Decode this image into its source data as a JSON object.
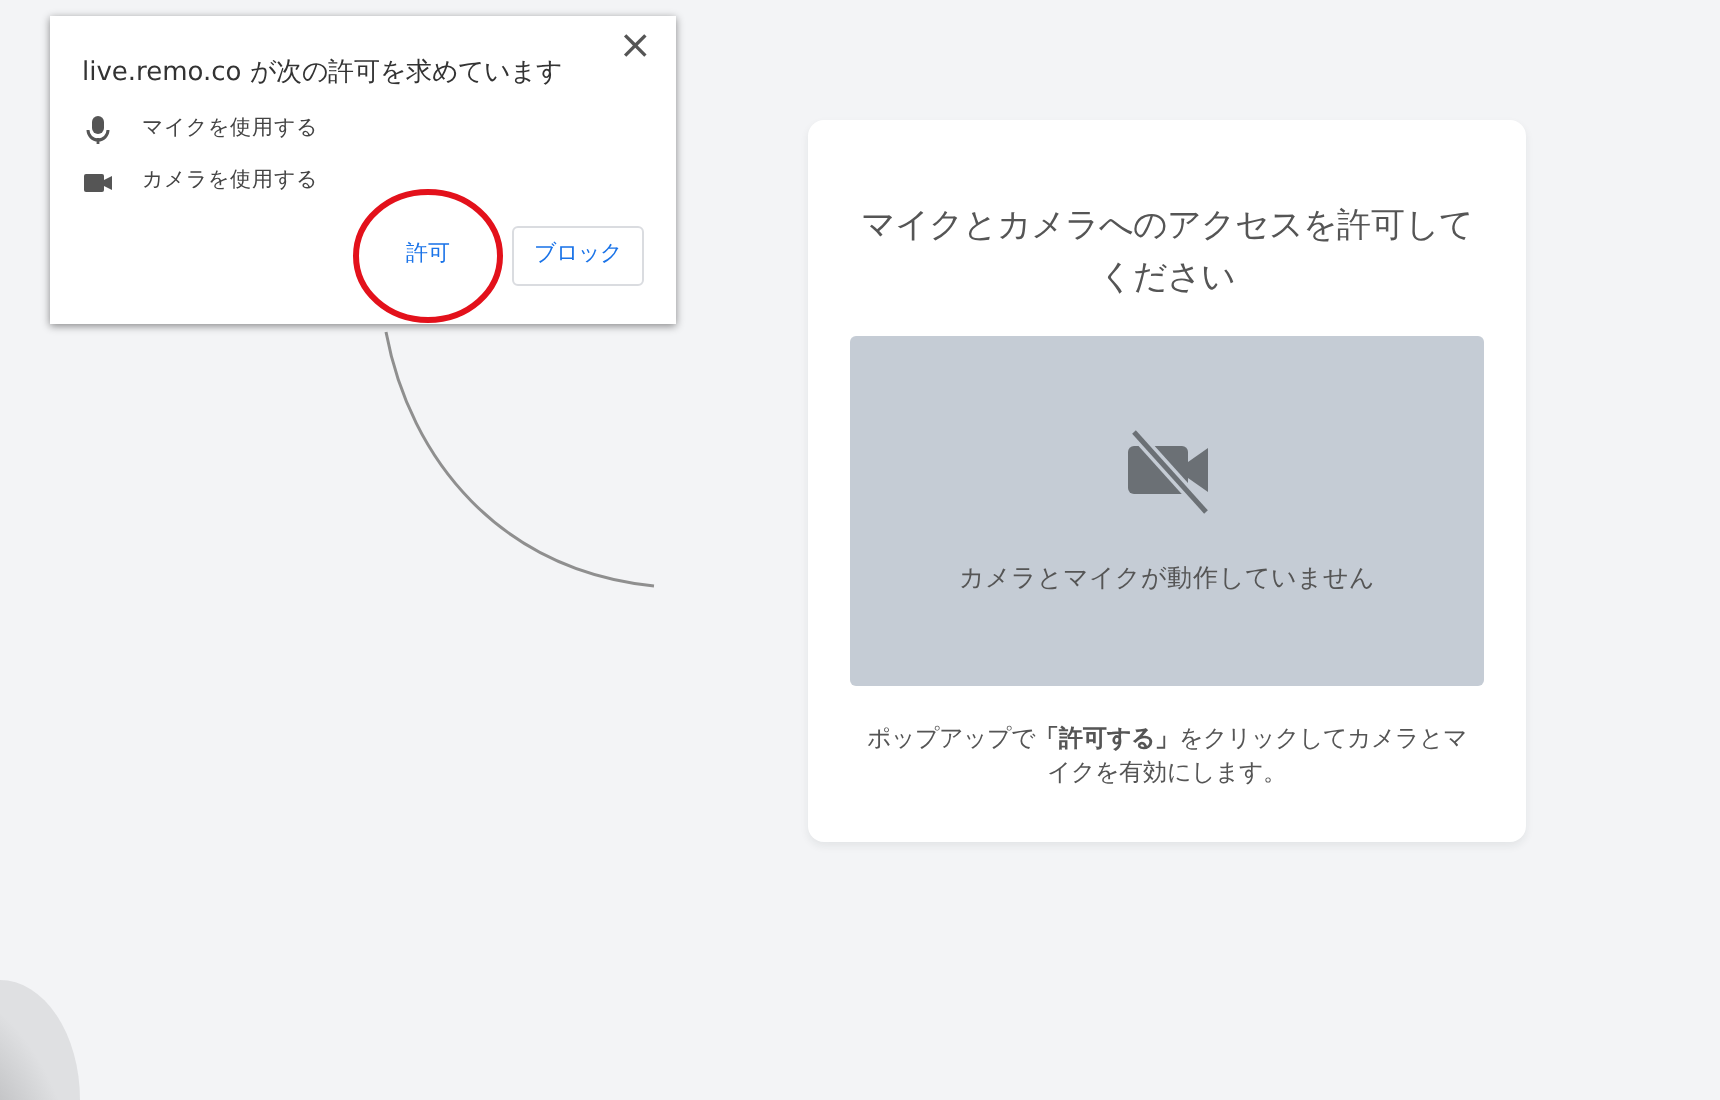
{
  "permission_popup": {
    "title": "live.remo.co が次の許可を求めています",
    "close": "×",
    "permissions": [
      {
        "kind": "mic",
        "label": "マイクを使用する"
      },
      {
        "kind": "camera",
        "label": "カメラを使用する"
      }
    ],
    "buttons": [
      {
        "label": "許可",
        "highlighted": true,
        "bordered": false
      },
      {
        "label": "ブロック",
        "highlighted": false,
        "bordered": true
      }
    ]
  },
  "access_card": {
    "title": "マイクとカメラへのアクセスを許可してください",
    "video_placeholder": {
      "message": "カメラとマイクが動作していません"
    },
    "instructions": "ポップアップで**「許可する」**をクリックしてカメラとマイクを有効にします。"
  }
}
